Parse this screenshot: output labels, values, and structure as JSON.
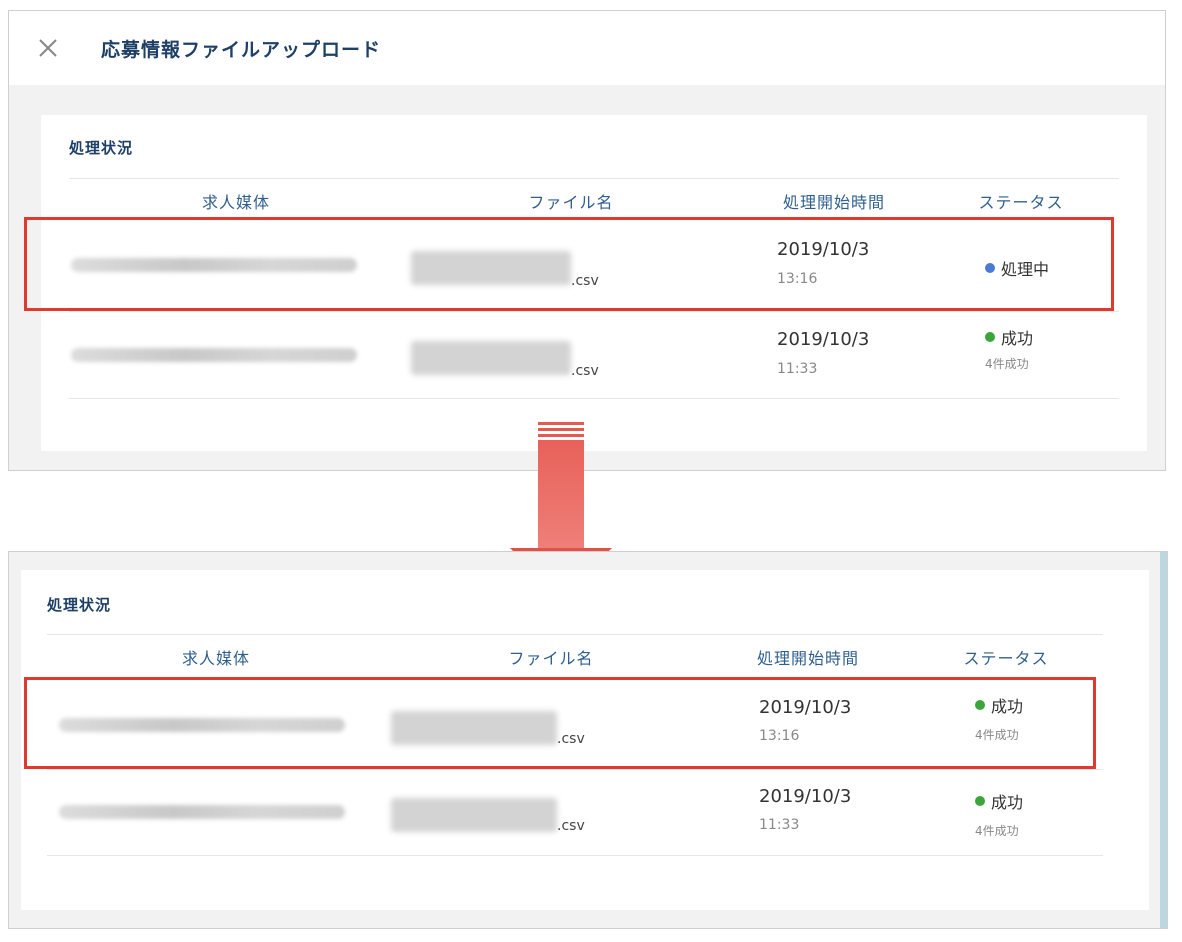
{
  "modal": {
    "title": "応募情報ファイルアップロード",
    "close_icon": "close-icon"
  },
  "section_title": "処理状況",
  "columns": [
    "求人媒体",
    "ファイル名",
    "処理開始時間",
    "ステータス"
  ],
  "colors": {
    "accent": "#1e3f66",
    "header_text": "#2f5f8f",
    "highlight": "#e03a2f",
    "processing": "#4a7bd1",
    "success": "#3aa53a",
    "arrow": "#e45a50"
  },
  "before": {
    "rows": [
      {
        "file_ext": ".csv",
        "date": "2019/10/3",
        "time": "13:16",
        "status": "処理中",
        "status_color": "#4a7bd1",
        "substatus": ""
      },
      {
        "file_ext": ".csv",
        "date": "2019/10/3",
        "time": "11:33",
        "status": "成功",
        "status_color": "#3aa53a",
        "substatus": "4件成功"
      }
    ]
  },
  "after": {
    "rows": [
      {
        "file_ext": ".csv",
        "date": "2019/10/3",
        "time": "13:16",
        "status": "成功",
        "status_color": "#3aa53a",
        "substatus": "4件成功"
      },
      {
        "file_ext": ".csv",
        "date": "2019/10/3",
        "time": "11:33",
        "status": "成功",
        "status_color": "#3aa53a",
        "substatus": "4件成功"
      }
    ]
  }
}
